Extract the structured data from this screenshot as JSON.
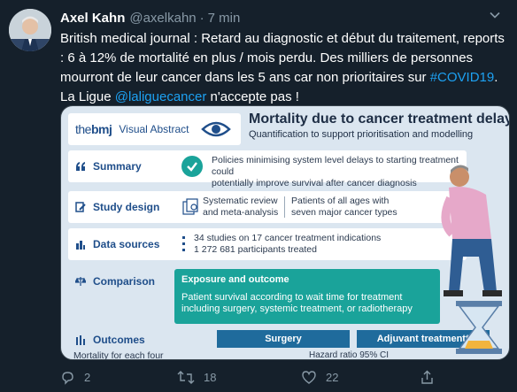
{
  "author": {
    "name": "Axel Kahn",
    "handle": "@axelkahn",
    "separator": "·",
    "time": "7 min"
  },
  "tweet": {
    "text_1": "British medical journal : Retard au diagnostic et début du traitement, reports : 6 à 12% de mortalité en plus / mois perdu. Des milliers de personnes mourront de leur cancer dans les 5 ans car non prioritaires sur ",
    "hashtag": "#COVID19",
    "text_2": ". La Ligue ",
    "mention": "@laliguecancer",
    "text_3": " n'accepte pas !"
  },
  "image": {
    "logo_the": "the",
    "logo_bmj": "bmj",
    "logo_label": "Visual Abstract",
    "title": "Mortality due to cancer treatment delay",
    "subtitle": "Quantification to support prioritisation and modelling",
    "summary_label": "Summary",
    "summary_text_1": "Policies minimising system level delays to starting treatment could",
    "summary_text_2": "potentially improve survival after cancer diagnosis",
    "study_label": "Study design",
    "study_text_1a": "Systematic review",
    "study_text_1b": "and meta-analysis",
    "study_text_2a": "Patients of all ages with",
    "study_text_2b": "seven major cancer types",
    "data_label": "Data sources",
    "data_text_1": "34 studies on 17 cancer treatment indications",
    "data_text_2": "1 272 681 participants treated",
    "comparison_label": "Comparison",
    "exposure_head": "Exposure and outcome",
    "exposure_body": "Patient survival according to wait time for treatment including surgery, systemic treatment, or radiotherapy",
    "outcomes_label": "Outcomes",
    "surgery": "Surgery",
    "adjuvant": "Adjuvant treatment*",
    "outcome_text": "Mortality for each four",
    "hazard": "Hazard ratio   95% CI"
  },
  "actions": {
    "reply_count": "2",
    "retweet_count": "18",
    "like_count": "22"
  },
  "colors": {
    "background": "#15202b",
    "link": "#1da1f2",
    "muted": "#8899a6",
    "bmj_blue": "#1f4e8a",
    "teal": "#1aa39a"
  }
}
